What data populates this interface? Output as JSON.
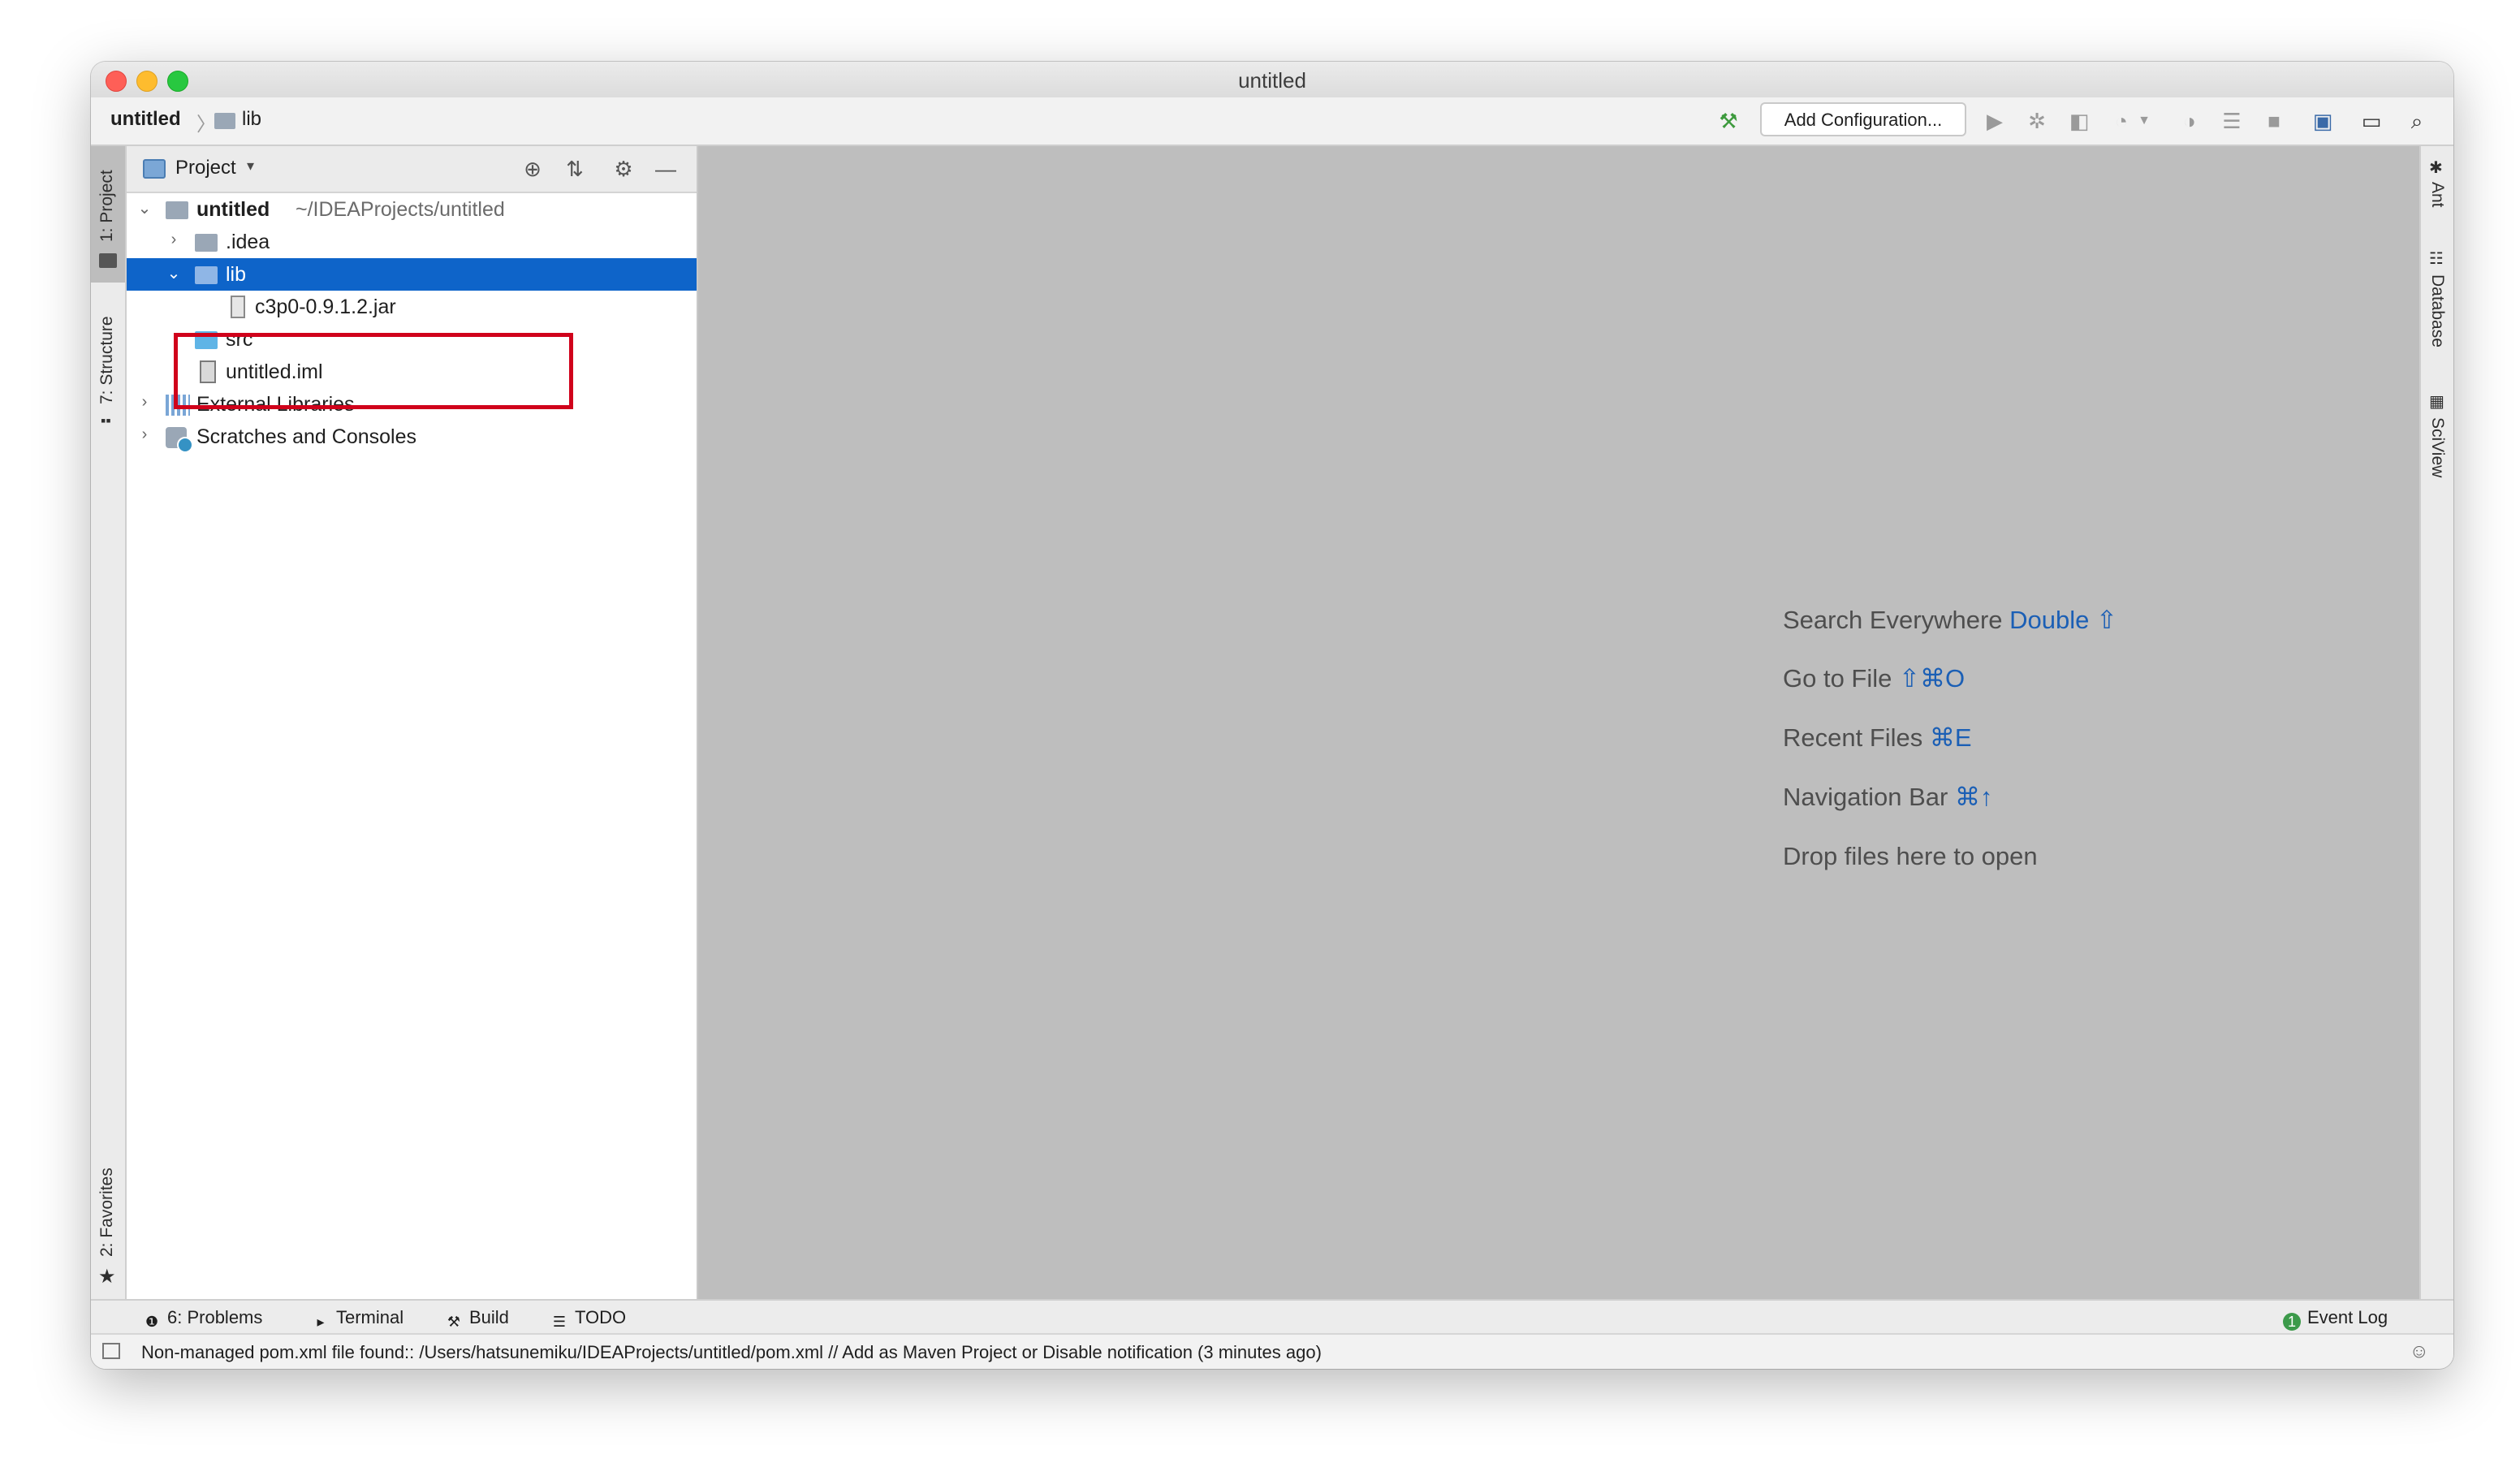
{
  "window": {
    "title": "untitled"
  },
  "navbar": {
    "breadcrumb_root": "untitled",
    "breadcrumb_sep": "〉",
    "breadcrumb_child": "lib",
    "add_config_label": "Add Configuration..."
  },
  "left_tabs": [
    {
      "label": "1: Project"
    },
    {
      "label": "7: Structure"
    },
    {
      "label": "2: Favorites"
    }
  ],
  "right_tabs": [
    {
      "label": "Ant"
    },
    {
      "label": "Database"
    },
    {
      "label": "SciView"
    }
  ],
  "project_panel": {
    "title": "Project",
    "caret": "▾"
  },
  "tree": {
    "root": {
      "name": "untitled",
      "path": "~/IDEAProjects/untitled",
      "arrow": "⌄"
    },
    "idea": {
      "name": ".idea",
      "arrow": "›"
    },
    "lib": {
      "name": "lib",
      "arrow": "⌄"
    },
    "jar": {
      "name": "c3p0-0.9.1.2.jar"
    },
    "src": {
      "name": "src"
    },
    "iml": {
      "name": "untitled.iml"
    },
    "ext": {
      "name": "External Libraries",
      "arrow": "›"
    },
    "scratch": {
      "name": "Scratches and Consoles",
      "arrow": "›"
    }
  },
  "editor_hints": [
    {
      "text": "Search Everywhere",
      "key": "Double ⇧"
    },
    {
      "text": "Go to File",
      "key": "⇧⌘O"
    },
    {
      "text": "Recent Files",
      "key": "⌘E"
    },
    {
      "text": "Navigation Bar",
      "key": "⌘↑"
    },
    {
      "text": "Drop files here to open",
      "key": ""
    }
  ],
  "bottom_tools": {
    "problems": "6: Problems",
    "terminal": "Terminal",
    "build": "Build",
    "todo": "TODO",
    "event_log": "Event Log"
  },
  "status": {
    "message": "Non-managed pom.xml file found:: /Users/hatsunemiku/IDEAProjects/untitled/pom.xml // Add as Maven Project or Disable notification (3 minutes ago)"
  },
  "colors": {
    "selection": "#0e64c9",
    "highlight_border": "#d0021b",
    "editor_bg": "#bebebe",
    "hint_key": "#1b5fb5"
  }
}
